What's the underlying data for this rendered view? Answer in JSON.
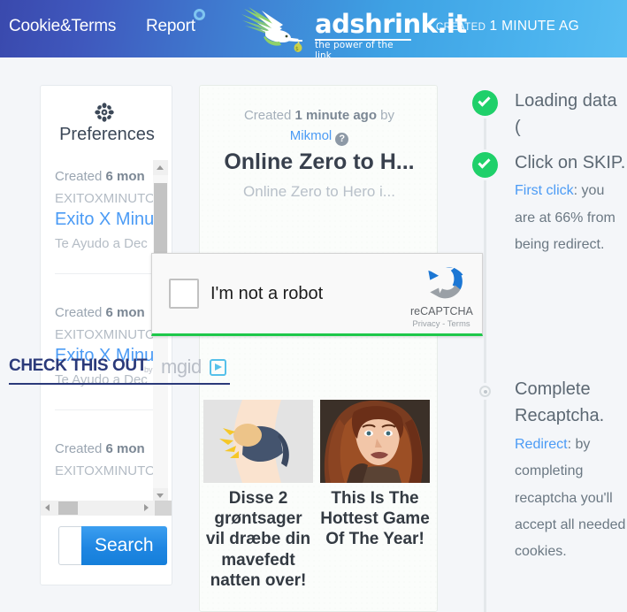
{
  "header": {
    "nav": [
      {
        "label": "Cookie&Terms",
        "name": "nav-cookie-terms"
      },
      {
        "label": "Report",
        "name": "nav-report"
      }
    ],
    "logo_word": "adshrink.it",
    "logo_tagline": "the power of the link",
    "created_label": "CREATED",
    "created_value": "1 MINUTE AG",
    "colors": {
      "start": "#3a49ad",
      "end": "#57bdf2"
    }
  },
  "sidebar": {
    "icon": "gear-icon",
    "title": "Preferences",
    "items": [
      {
        "created_prefix": "Created ",
        "created_value": "6 mon",
        "code": "EXITOXMINUTO",
        "title": "Exito X Minu",
        "subtitle": "Te Ayudo a Dec"
      },
      {
        "created_prefix": "Created ",
        "created_value": "6 mon",
        "code": "EXITOXMINUTO",
        "title": "Exito X Minu",
        "subtitle": "Te Ayudo a Dec"
      },
      {
        "created_prefix": "Created ",
        "created_value": "6 mon",
        "code": "EXITOXMINUTO",
        "title": "",
        "subtitle": ""
      }
    ],
    "search_value": "",
    "search_placeholder": "",
    "search_button": "Search"
  },
  "center": {
    "created_prefix": "Created ",
    "created_value": "1 minute ago",
    "created_suffix": " by",
    "author": "Mikmol",
    "help_icon": "question-mark-icon",
    "title": "Online Zero to H...",
    "description": "Online Zero to Hero i...",
    "ad": {
      "heading": "CHECK THIS OUT",
      "by_label": "by",
      "network": "mgid",
      "cards": [
        {
          "caption": "Disse 2 grøntsager vil dræbe din mavefedt natten over!",
          "image": "belly-fat-illustration"
        },
        {
          "caption": "This Is The Hottest Game Of The Year!",
          "image": "woman-portrait-illustration"
        }
      ]
    }
  },
  "recaptcha": {
    "checkbox_label": "I'm not a robot",
    "brand": "reCAPTCHA",
    "terms": "Privacy - Terms",
    "checked": false,
    "accent": "#1ec84a"
  },
  "steps": [
    {
      "state": "done",
      "title": "Loading data (",
      "detail_parts": []
    },
    {
      "state": "done",
      "title": "Click on SKIP.",
      "detail_parts": [
        {
          "text": "First click",
          "highlight": true
        },
        {
          "text": ": you are at 66% from being redirect.",
          "highlight": false
        }
      ]
    },
    {
      "state": "pending",
      "title": "Complete Recaptcha.",
      "detail_parts": [
        {
          "text": "Redirect",
          "highlight": true
        },
        {
          "text": ": by completing recaptcha you'll accept all needed cookies.",
          "highlight": false
        }
      ]
    }
  ]
}
